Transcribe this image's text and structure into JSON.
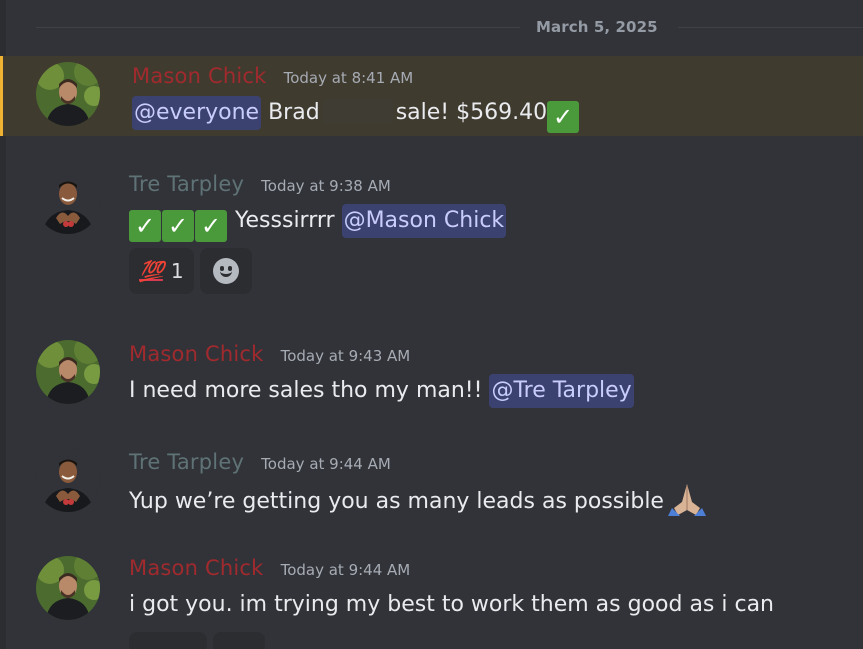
{
  "date_divider": "March 5, 2025",
  "colors": {
    "background": "#313338",
    "highlight_bg": "#403b2f",
    "highlight_bar": "#f0b232",
    "mason_name": "#a02a2e",
    "tre_name": "#5f7377",
    "mention_bg": "#3c4270",
    "mention_text": "#c9cdfb",
    "check_green": "#4a9a3b"
  },
  "messages": [
    {
      "author": "Mason Chick",
      "timestamp": "Today at 8:41 AM",
      "mention": "@everyone",
      "text_before": "Brad",
      "text_after": "sale! $569.40",
      "emoji": "check-mark-button"
    },
    {
      "author": "Tre Tarpley",
      "timestamp": "Today at 9:38 AM",
      "emoji": "check-mark-button x3",
      "text": "Yesssirrrr",
      "mention": "@Mason Chick",
      "reactions": [
        {
          "emoji": "100-icon",
          "label": "💯",
          "count": "1"
        }
      ]
    },
    {
      "author": "Mason Chick",
      "timestamp": "Today at 9:43 AM",
      "text": "I need more sales tho my man!!",
      "mention": "@Tre Tarpley"
    },
    {
      "author": "Tre Tarpley",
      "timestamp": "Today at 9:44 AM",
      "text": "Yup we’re getting you as many leads as possible",
      "emoji": "folded-hands"
    },
    {
      "author": "Mason Chick",
      "timestamp": "Today at 9:44 AM",
      "text": "i got you. im trying my best to work them as good as i can"
    }
  ]
}
